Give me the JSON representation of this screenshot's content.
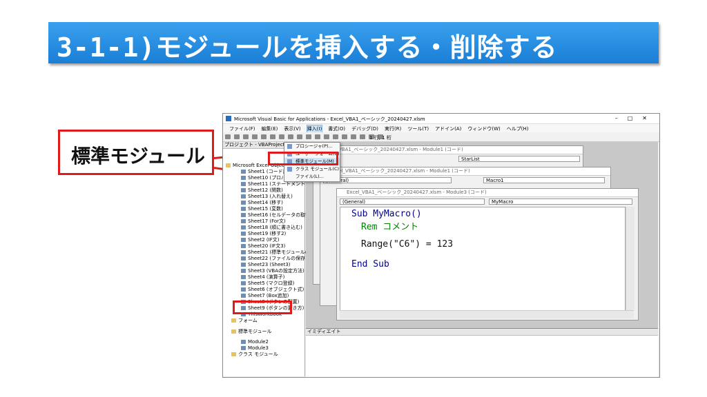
{
  "slide_title": "3-1-1)モジュールを挿入する・削除する",
  "callout_label": "標準モジュール",
  "vbe": {
    "window_title": "Microsoft Visual Basic for Applications - Excel_VBA1_ベーシック_20240427.xlsm",
    "menu": [
      "ファイル(F)",
      "編集(E)",
      "表示(V)",
      "挿入(I)",
      "書式(O)",
      "デバッグ(D)",
      "実行(R)",
      "ツール(T)",
      "アドイン(A)",
      "ウィンドウ(W)",
      "ヘルプ(H)"
    ],
    "cursor_pos": "1 行, 1 桁",
    "project_title": "プロジェクト - VBAProject",
    "insert_menu": [
      "プロシージャ(P)...",
      "ユーザー フォーム(U)",
      "標準モジュール(M)",
      "クラス モジュール(C)",
      "ファイル(L)..."
    ],
    "tree": [
      "Microsoft Excel Objects",
      "Sheet1 (コード記述)",
      "Sheet10 (プロパティ)",
      "Sheet11 (ステートメント)",
      "Sheet12 (関数)",
      "Sheet13 (入れ替え)",
      "Sheet14 (移す)",
      "Sheet15 (変数)",
      "Sheet16 (セルデータの取得)",
      "Sheet17 (For文)",
      "Sheet18 (順に書き込む)",
      "Sheet19 (移す2)",
      "Sheet2 (IF文)",
      "Sheet20 (IF文3)",
      "Sheet21 (標準モジュールの追加)",
      "Sheet22 (ファイルの保存)",
      "Sheet23 (Sheet3)",
      "Sheet3 (VBAの設定方法)",
      "Sheet4 (演算子)",
      "Sheet5 (マクロ登録)",
      "Sheet6 (オブジェクト式)",
      "Sheet7 (Box追加)",
      "Sheet8 (ボタンの配置)",
      "Sheet9 (ボタンの置き方)",
      "ThisWorkbook",
      "フォーム",
      "標準モジュール",
      "Module2",
      "Module3",
      "クラス モジュール"
    ],
    "win1": {
      "title": "Excel_VBA1_ベーシック_20240427.xlsm - Module1 (コード)",
      "right_combo": "StarList"
    },
    "win2": {
      "title": "Excel_VBA1_ベーシック_20240427.xlsm - Module1 (コード)",
      "left_combo": "(General)",
      "right_combo": "Macro1"
    },
    "win3": {
      "title": "Excel_VBA1_ベーシック_20240427.xlsm - Module3 (コード)",
      "left_combo": "(General)",
      "right_combo": "MyMacro"
    },
    "code": [
      "Sub MyMacro()",
      "Rem コメント",
      "Range(\"C6\") = 123",
      "End Sub"
    ],
    "immediate_title": "イミディエイト"
  }
}
